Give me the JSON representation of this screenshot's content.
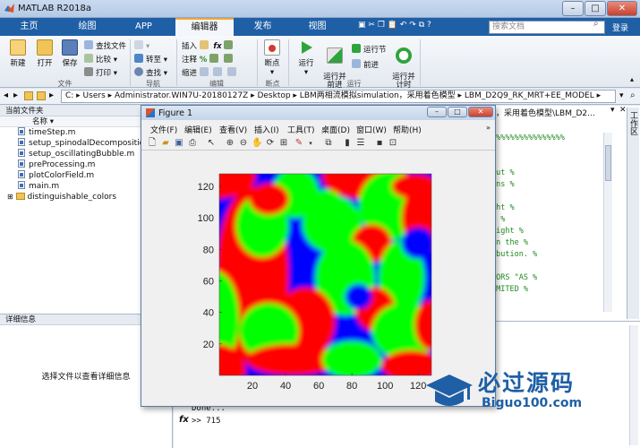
{
  "app": {
    "title": "MATLAB R2018a"
  },
  "window_controls": {
    "minimize": "–",
    "maximize": "□",
    "close": "✕"
  },
  "tabs": [
    {
      "label": "主页",
      "active": false
    },
    {
      "label": "绘图",
      "active": false
    },
    {
      "label": "APP",
      "active": false
    },
    {
      "label": "编辑器",
      "active": true
    },
    {
      "label": "发布",
      "active": false
    },
    {
      "label": "视图",
      "active": false
    }
  ],
  "search": {
    "placeholder": "搜索文档"
  },
  "login": "登录",
  "toolstrip": {
    "file": {
      "new": "新建",
      "open": "打开",
      "save": "保存",
      "find_files": "查找文件",
      "compare": "比较",
      "print": "打印",
      "group": "文件"
    },
    "navigate": {
      "goto": "转至",
      "find": "查找",
      "group": "导航"
    },
    "edit": {
      "insert": "插入",
      "comment": "注释",
      "indent": "缩进",
      "fx": "fx",
      "group": "编辑"
    },
    "breakpoints": {
      "label": "断点",
      "group": "断点"
    },
    "run": {
      "run": "运行",
      "run_advance": "运行并\n前进",
      "run_section": "运行节",
      "advance": "前进",
      "run_time": "运行并\n计时",
      "group": "运行"
    }
  },
  "address": {
    "path": "C: ▸ Users ▸ Administrator.WIN7U-20180127Z ▸ Desktop ▸ LBM两相流模拟simulation，采用着色模型 ▸ LBM_D2Q9_RK_MRT+EE_MODEL ▸"
  },
  "current_folder": {
    "title": "当前文件夹",
    "col_name": "名称",
    "files": [
      "timeStep.m",
      "setup_spinodalDecomposition....",
      "setup_oscillatingBubble.m",
      "preProcessing.m",
      "plotColorField.m",
      "main.m"
    ],
    "folder": "distinguishable_colors"
  },
  "details": {
    "title": "详细信息",
    "hint": "选择文件以查看详细信息"
  },
  "editor": {
    "right_path": "，采用着色模型\\LBM_D2...",
    "side_label": "工作区",
    "lines": [
      "%%%%%%%%%%%%%%%%",
      "               %",
      "               %",
      "out            %",
      "ons            %",
      "               %",
      "ght            %",
      ".              %",
      "right          %",
      " in the        %",
      "ibution.       %",
      "               %",
      "TORS \"AS       %",
      "IMITED         %"
    ]
  },
  "command": {
    "done": "Done...",
    "prompt": ">> 715",
    "fx": "fx"
  },
  "figure": {
    "title": "Figure 1",
    "menu": [
      "文件(F)",
      "编辑(E)",
      "查看(V)",
      "插入(I)",
      "工具(T)",
      "桌面(D)",
      "窗口(W)",
      "帮助(H)"
    ],
    "tools": [
      "new-figure",
      "open",
      "save",
      "print",
      "pointer",
      "zoom-in",
      "zoom-out",
      "pan",
      "rotate",
      "data-cursor",
      "brush",
      "link",
      "colorbar",
      "legend",
      "hide-tools",
      "dock"
    ]
  },
  "chart_data": {
    "type": "heatmap",
    "xticks": [
      20,
      40,
      60,
      80,
      100,
      120
    ],
    "yticks": [
      20,
      40,
      60,
      80,
      100,
      120
    ],
    "xlim": [
      0,
      128
    ],
    "ylim": [
      0,
      128
    ],
    "colors": {
      "phase1": "#ff0000",
      "phase2": "#00ff00",
      "phase3": "#0000ff"
    },
    "phases": [
      "phase1",
      "phase2",
      "phase3"
    ]
  },
  "watermark": {
    "cn": "必过源码",
    "url": "Biguo100.com"
  },
  "colors": {
    "ribbon": "#1f5fa5",
    "accent": "#f3a63a"
  }
}
